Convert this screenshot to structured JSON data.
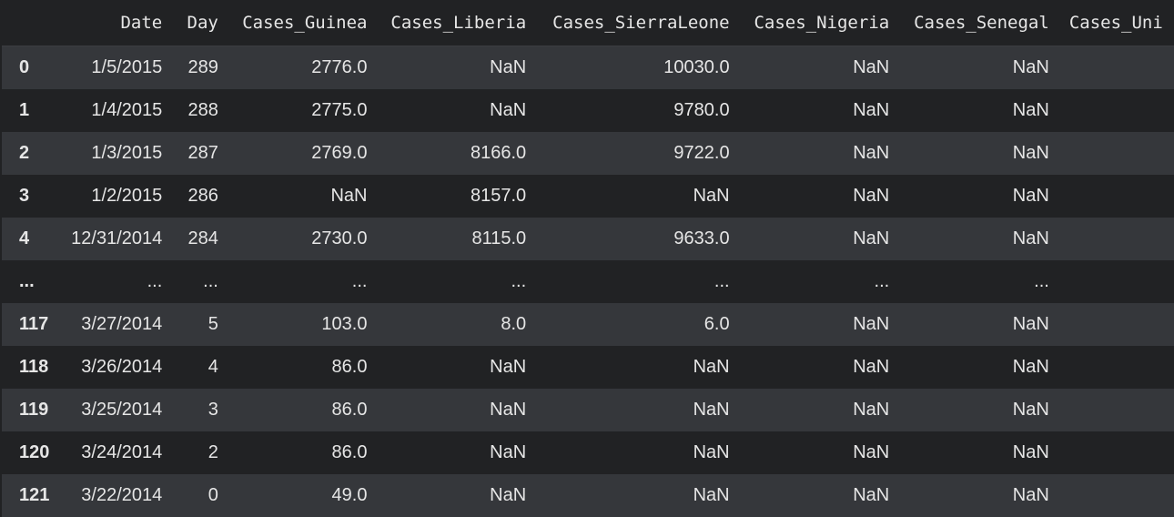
{
  "table": {
    "columns": [
      "",
      "Date",
      "Day",
      "Cases_Guinea",
      "Cases_Liberia",
      "Cases_SierraLeone",
      "Cases_Nigeria",
      "Cases_Senegal",
      "Cases_Uni"
    ],
    "rows": [
      {
        "index": "0",
        "cells": [
          "1/5/2015",
          "289",
          "2776.0",
          "NaN",
          "10030.0",
          "NaN",
          "NaN",
          ""
        ]
      },
      {
        "index": "1",
        "cells": [
          "1/4/2015",
          "288",
          "2775.0",
          "NaN",
          "9780.0",
          "NaN",
          "NaN",
          ""
        ]
      },
      {
        "index": "2",
        "cells": [
          "1/3/2015",
          "287",
          "2769.0",
          "8166.0",
          "9722.0",
          "NaN",
          "NaN",
          ""
        ]
      },
      {
        "index": "3",
        "cells": [
          "1/2/2015",
          "286",
          "NaN",
          "8157.0",
          "NaN",
          "NaN",
          "NaN",
          ""
        ]
      },
      {
        "index": "4",
        "cells": [
          "12/31/2014",
          "284",
          "2730.0",
          "8115.0",
          "9633.0",
          "NaN",
          "NaN",
          ""
        ]
      },
      {
        "index": "...",
        "cells": [
          "...",
          "...",
          "...",
          "...",
          "...",
          "...",
          "...",
          ""
        ]
      },
      {
        "index": "117",
        "cells": [
          "3/27/2014",
          "5",
          "103.0",
          "8.0",
          "6.0",
          "NaN",
          "NaN",
          ""
        ]
      },
      {
        "index": "118",
        "cells": [
          "3/26/2014",
          "4",
          "86.0",
          "NaN",
          "NaN",
          "NaN",
          "NaN",
          ""
        ]
      },
      {
        "index": "119",
        "cells": [
          "3/25/2014",
          "3",
          "86.0",
          "NaN",
          "NaN",
          "NaN",
          "NaN",
          ""
        ]
      },
      {
        "index": "120",
        "cells": [
          "3/24/2014",
          "2",
          "86.0",
          "NaN",
          "NaN",
          "NaN",
          "NaN",
          ""
        ]
      },
      {
        "index": "121",
        "cells": [
          "3/22/2014",
          "0",
          "49.0",
          "NaN",
          "NaN",
          "NaN",
          "NaN",
          ""
        ]
      }
    ]
  },
  "colors": {
    "background": "#212224",
    "stripe": "#35373b",
    "text": "#e6e6e6"
  }
}
